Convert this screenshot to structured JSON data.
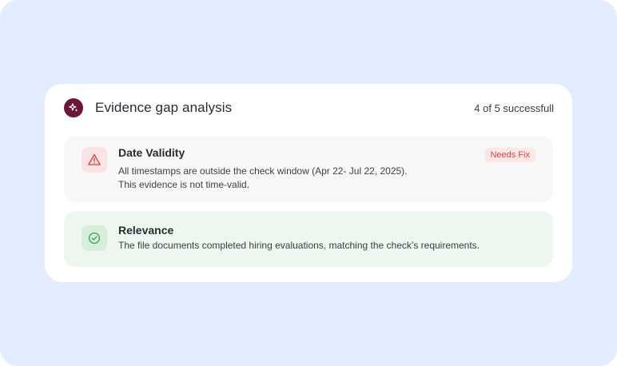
{
  "panel": {
    "title": "Evidence gap analysis",
    "summary": "4 of 5 successfull",
    "brand_icon": "sparkle-icon"
  },
  "checks": [
    {
      "title": "Date Validity",
      "status": "fail",
      "icon": "warning-triangle-icon",
      "badge": "Needs Fix",
      "description_lines": [
        "All timestamps are outside the check window (Apr 22- Jul 22, 2025).",
        "This evidence is not time-valid."
      ]
    },
    {
      "title": "Relevance",
      "status": "pass",
      "icon": "check-circle-icon",
      "description_lines": [
        "The file documents completed hiring evaluations, matching the check’s requirements."
      ]
    }
  ],
  "colors": {
    "background": "#e4edff",
    "brand": "#6b1538",
    "fail_accent": "#d64545",
    "pass_accent": "#3aa356",
    "pass_row": "#edf7ef",
    "fail_row": "#f8f8f8"
  }
}
